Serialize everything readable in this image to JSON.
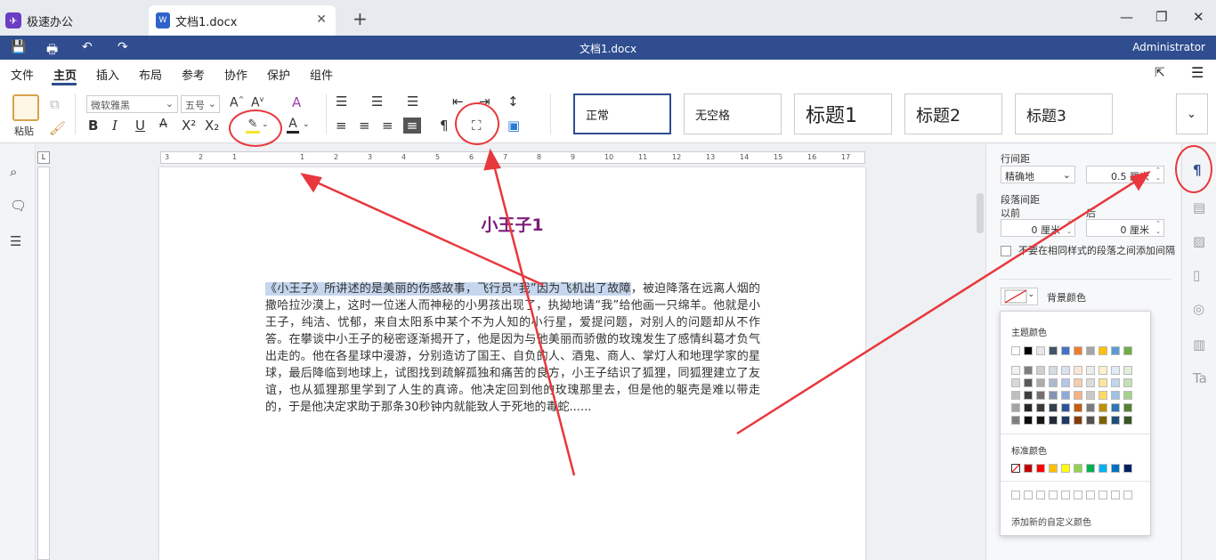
{
  "tabs": {
    "app": {
      "label": "极速办公",
      "icon": "app-logo"
    },
    "doc": {
      "label": "文档1.docx",
      "icon": "word-doc-icon"
    },
    "add": "+",
    "close": "✕"
  },
  "window": {
    "title": "文档1.docx",
    "user": "Administrator"
  },
  "menu": [
    "文件",
    "主页",
    "插入",
    "布局",
    "参考",
    "协作",
    "保护",
    "组件"
  ],
  "menu_active": "主页",
  "ribbon": {
    "paste_label": "粘贴",
    "font_name": "微软雅黑",
    "font_size": "五号",
    "styles": [
      "正常",
      "无空格",
      "标题1",
      "标题2",
      "标题3"
    ]
  },
  "document": {
    "title": "小王子1",
    "paragraph_highlighted": "《小王子》所讲述的是美丽的伤感故事，飞行员“我”因为飞机出了故障",
    "paragraph_rest": "，被迫降落在远离人烟的撒哈拉沙漠上，这时一位迷人而神秘的小男孩出现了，执拗地请“我”给他画一只绵羊。他就是小王子，纯洁、忧郁，来自太阳系中某个不为人知的小行星，爱提问题，对别人的问题却从不作答。在攀谈中小王子的秘密逐渐揭开了，他是因为与他美丽而骄傲的玫瑰发生了感情纠葛才负气出走的。他在各星球中漫游，分别造访了国王、自负的人、酒鬼、商人、掌灯人和地理学家的星球，最后降临到地球上，试图找到疏解孤独和痛苦的良方，小王子结识了狐狸，同狐狸建立了友谊，也从狐狸那里学到了人生的真谛。他决定回到他的玫瑰那里去，但是他的躯壳是难以带走的，于是他决定求助于那条30秒钟内就能致人于死地的毒蛇......"
  },
  "panel": {
    "line_spacing_label": "行间距",
    "line_spacing_mode": "精确地",
    "line_spacing_value": "0.5 厘米",
    "para_spacing_label": "段落间距",
    "before_label": "以前",
    "after_label": "后",
    "before_value": "0 厘米",
    "after_value": "0 厘米",
    "checkbox_label": "不要在相同样式的段落之间添加间隔",
    "bg_color_label": "背景颜色"
  },
  "color_popup": {
    "theme_title": "主题颜色",
    "standard_title": "标准颜色",
    "add_custom": "添加新的自定义颜色",
    "theme_top": [
      "#ffffff",
      "#000000",
      "#e7e6e6",
      "#44546a",
      "#4472c4",
      "#ed7d31",
      "#a5a5a5",
      "#ffc000",
      "#5b9bd5",
      "#70ad47"
    ],
    "theme_shades": [
      [
        "#f2f2f2",
        "#7f7f7f",
        "#d0cece",
        "#d6dce4",
        "#d9e2f3",
        "#fbe5d5",
        "#ededed",
        "#fff2cc",
        "#deebf6",
        "#e2efd9"
      ],
      [
        "#d8d8d8",
        "#595959",
        "#aeabab",
        "#adb9ca",
        "#b4c6e7",
        "#f7cbac",
        "#dbdbdb",
        "#fee599",
        "#bdd7ee",
        "#c5e0b3"
      ],
      [
        "#bfbfbf",
        "#3f3f3f",
        "#757070",
        "#8496b0",
        "#8eaadb",
        "#f4b183",
        "#c9c9c9",
        "#ffd965",
        "#9cc3e5",
        "#a8d08d"
      ],
      [
        "#a5a5a5",
        "#262626",
        "#3a3838",
        "#323f4f",
        "#2f5496",
        "#c55a11",
        "#7b7b7b",
        "#bf9000",
        "#2e75b5",
        "#538135"
      ],
      [
        "#7f7f7f",
        "#0c0c0c",
        "#171616",
        "#222a35",
        "#1e3864",
        "#843c0b",
        "#525252",
        "#7f6000",
        "#1e4e79",
        "#375623"
      ]
    ],
    "standard": [
      "#c00000",
      "#ff0000",
      "#ffc000",
      "#ffff00",
      "#92d050",
      "#00b050",
      "#00b0f0",
      "#0070c0",
      "#002060"
    ]
  }
}
